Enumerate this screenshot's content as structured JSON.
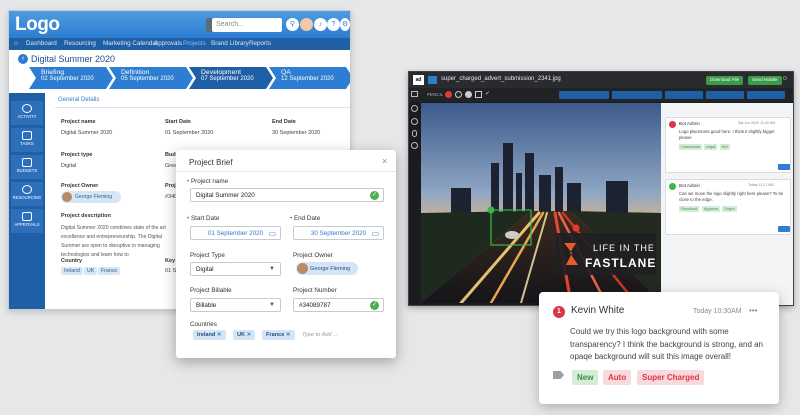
{
  "app": {
    "logo": "Logo",
    "search_placeholder": "Search...",
    "nav": [
      "Dashboard",
      "Resourcing",
      "Marketing Calendar",
      "Approvals",
      "Projects",
      "Brand Library",
      "Reports"
    ],
    "page_title": "Digital Summer 2020",
    "steps": [
      {
        "name": "Briefing",
        "date": "02 September 2020"
      },
      {
        "name": "Definition",
        "date": "05 September 2020"
      },
      {
        "name": "Development",
        "date": "07 September 2020"
      },
      {
        "name": "QA",
        "date": "12 September 2020"
      }
    ],
    "sidebar": [
      "ACTIVITY",
      "TASKS",
      "BUDGETS",
      "RESOURCING",
      "APPROVALS"
    ],
    "tab": "General Details",
    "project_name_label": "Project name",
    "project_name_value": "Digital Summer 2020",
    "start_label": "Start Date",
    "start_value": "01 September 2020",
    "end_label": "End Date",
    "end_value": "30 September 2020",
    "type_label": "Project type",
    "type_value": "Digital",
    "budget_label": "Bud",
    "budget_value": "Great",
    "owner_label": "Project Owner",
    "owner_value": "George Fleming",
    "proj_label": "Proje",
    "proj_value": "#340",
    "desc_label": "Project description",
    "desc_text": "Digital Summer 2020 combines state of the art excellence and entrepreneurship. The Digital Summer are open to disruptive in managing technologies and learn how to",
    "country_label": "Country",
    "countries": [
      "Ireland",
      "UK",
      "France"
    ],
    "keyd_label": "Key D",
    "keyd_value": "01 Se"
  },
  "modal": {
    "title": "Project Brief",
    "close": "×",
    "name_label": "Project name",
    "name_value": "Digital Summer 2020",
    "start_label": "Start Date",
    "start_value": "01 September 2020",
    "end_label": "End Date",
    "end_value": "30 September 2020",
    "type_label": "Project Type",
    "type_value": "Digital",
    "owner_label": "Project Owner",
    "owner_value": "George Fleming",
    "billable_label": "Project Billable",
    "billable_value": "Billable",
    "number_label": "Project Number",
    "number_value": "#34089787",
    "countries_label": "Countries",
    "countries": [
      "Ireland",
      "UK",
      "France"
    ],
    "countries_placeholder": "Type to Add ..."
  },
  "viewer": {
    "filename": "super_charged_advert_submission_2341.jpg",
    "download": "Download File",
    "send": "Send Mobile",
    "tool_label": "PENCIL",
    "overlay_line1": "LIFE IN THE",
    "overlay_line2": "FASTLANE",
    "comments": [
      {
        "author": "Bot Admin",
        "time": "Sat Jun 2020 11:40 AM",
        "text": "Logo placement good here. I think it slightly bigger please",
        "tags": [
          "Unresolved",
          "Legal",
          "Bol"
        ]
      },
      {
        "author": "Bot Admin",
        "time": "Today 11:17 AM",
        "text": "Can we move the logo slightly right here please? To be close to the edge.",
        "tags": [
          "Resolved",
          "Approve",
          "Graph"
        ]
      }
    ]
  },
  "comment": {
    "badge": "1",
    "author": "Kevin White",
    "time": "Today 10:30AM",
    "more": "•••",
    "text": "Could we try this logo background with some transparency? I think the background is strong, and an opaqe background will suit this image overall!",
    "tags": [
      "New",
      "Auto",
      "Super Charged"
    ],
    "colors": {
      "new_bg": "#d6ecd8",
      "new_fg": "#3a8f45",
      "auto_bg": "#f8d9dc",
      "auto_fg": "#d9364c",
      "badge": "#d9364c"
    }
  }
}
